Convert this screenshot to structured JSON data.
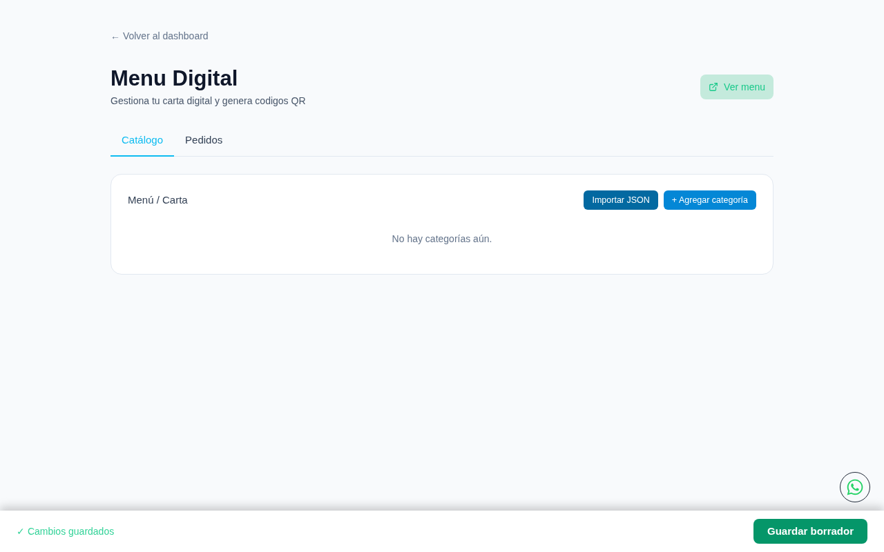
{
  "back_link": "← Volver al dashboard",
  "header": {
    "title": "Menu Digital",
    "subtitle": "Gestiona tu carta digital y genera codigos QR",
    "view_button": "Ver menu"
  },
  "tabs": [
    {
      "label": "Catálogo",
      "selected": true
    },
    {
      "label": "Pedidos",
      "selected": false
    }
  ],
  "card": {
    "title": "Menú / Carta",
    "buttons": [
      {
        "label": "Importar JSON",
        "kind": "dark"
      },
      {
        "label": "+ Agregar categoría",
        "kind": "bright"
      }
    ],
    "empty_message": "No hay categorías aún."
  },
  "footer": {
    "status": "✓ Cambios guardados",
    "save_button": "Guardar borrador"
  }
}
